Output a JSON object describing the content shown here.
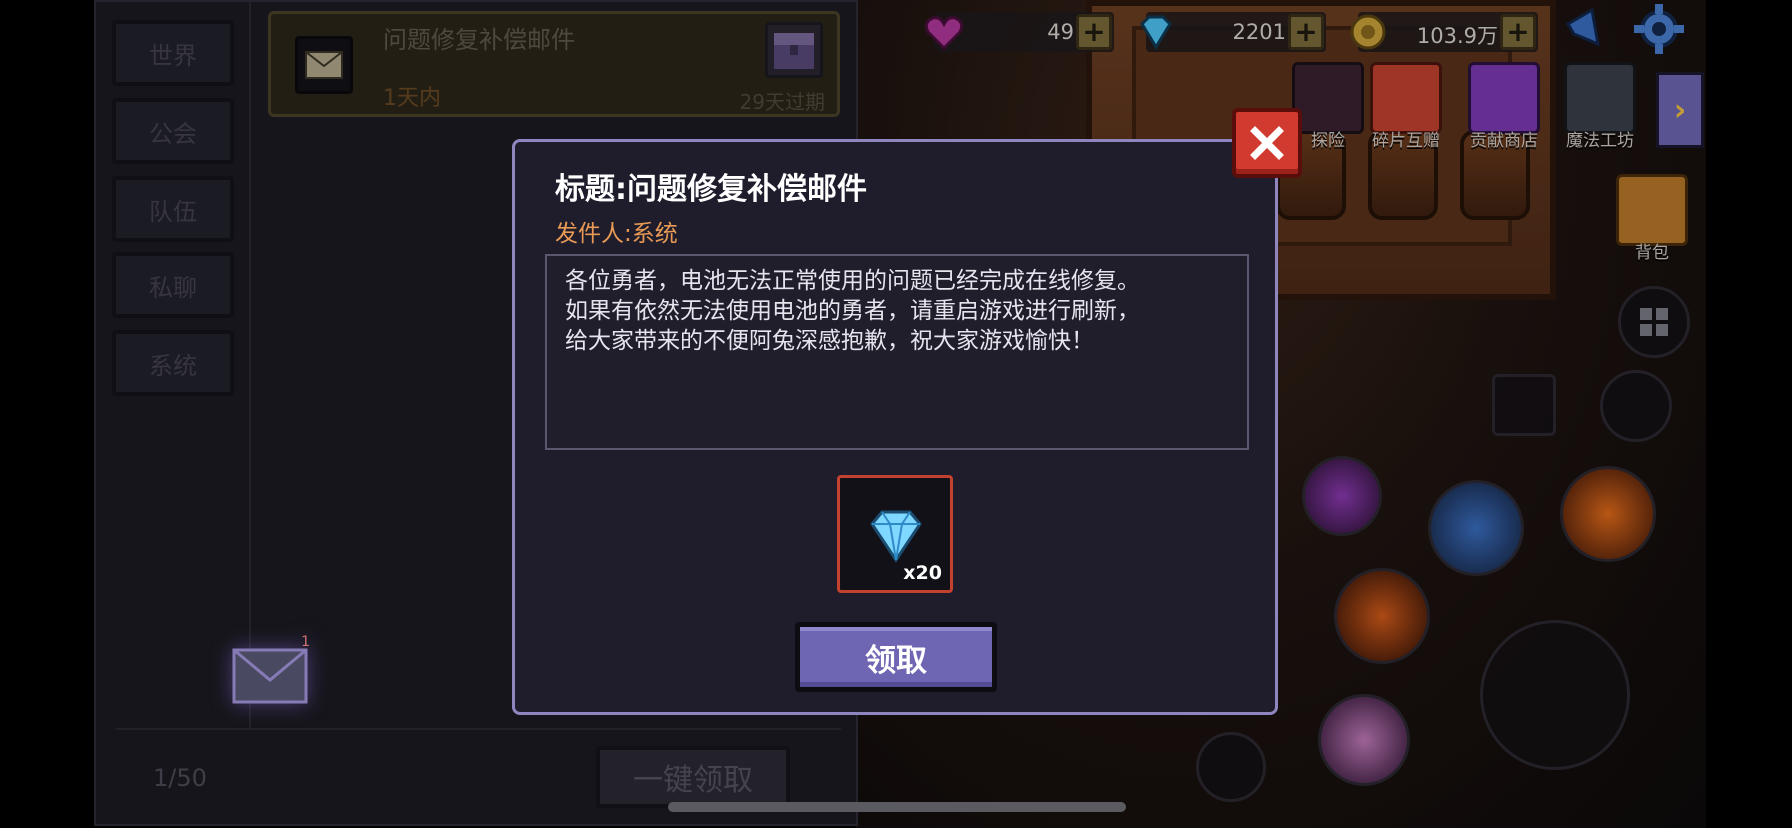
{
  "sidebar": {
    "tabs": [
      {
        "label": "世界"
      },
      {
        "label": "公会"
      },
      {
        "label": "队伍"
      },
      {
        "label": "私聊"
      },
      {
        "label": "系统"
      }
    ]
  },
  "mail_list": {
    "item": {
      "title": "问题修复补偿邮件",
      "time": "1天内",
      "expire": "29天过期"
    },
    "unread_badge": "1",
    "page_count": "1/50",
    "claim_all_label": "一键领取"
  },
  "currency": {
    "hearts": "49",
    "gems": "2201",
    "gold": "103.9万"
  },
  "hud": {
    "buttons": [
      {
        "label": "探险"
      },
      {
        "label": "碎片互赠"
      },
      {
        "label": "贡献商店"
      },
      {
        "label": "魔法工坊"
      }
    ],
    "bag_label": "背包"
  },
  "modal": {
    "title": "标题:问题修复补偿邮件",
    "sender": "发件人:系统",
    "body_lines": [
      "各位勇者，电池无法正常使用的问题已经完成在线修复。",
      "如果有依然无法使用电池的勇者，请重启游戏进行刷新，",
      "给大家带来的不便阿兔深感抱歉，祝大家游戏愉快！"
    ],
    "reward_qty": "x20",
    "claim_label": "领取"
  },
  "colors": {
    "accent": "#6e66b3",
    "sender": "#e89a55",
    "close": "#d03a2f",
    "reward_border": "#c2412f"
  }
}
